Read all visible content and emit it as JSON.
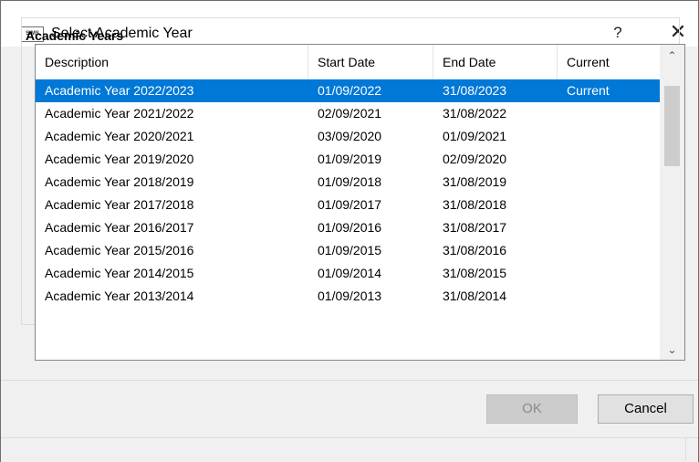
{
  "window": {
    "title": "Select Academic Year",
    "app_icon_label": "SIMS",
    "help_label": "?",
    "close_label": "✕"
  },
  "group": {
    "label": "Academic Years"
  },
  "table": {
    "columns": [
      "Description",
      "Start Date",
      "End Date",
      "Current"
    ],
    "rows": [
      {
        "description": "Academic Year 2022/2023",
        "start": "01/09/2022",
        "end": "31/08/2023",
        "current": "Current",
        "selected": true
      },
      {
        "description": "Academic Year 2021/2022",
        "start": "02/09/2021",
        "end": "31/08/2022",
        "current": ""
      },
      {
        "description": "Academic Year 2020/2021",
        "start": "03/09/2020",
        "end": "01/09/2021",
        "current": ""
      },
      {
        "description": "Academic Year 2019/2020",
        "start": "01/09/2019",
        "end": "02/09/2020",
        "current": ""
      },
      {
        "description": "Academic Year 2018/2019",
        "start": "01/09/2018",
        "end": "31/08/2019",
        "current": ""
      },
      {
        "description": "Academic Year 2017/2018",
        "start": "01/09/2017",
        "end": "31/08/2018",
        "current": ""
      },
      {
        "description": "Academic Year 2016/2017",
        "start": "01/09/2016",
        "end": "31/08/2017",
        "current": ""
      },
      {
        "description": "Academic Year 2015/2016",
        "start": "01/09/2015",
        "end": "31/08/2016",
        "current": ""
      },
      {
        "description": "Academic Year 2014/2015",
        "start": "01/09/2014",
        "end": "31/08/2015",
        "current": ""
      },
      {
        "description": "Academic Year 2013/2014",
        "start": "01/09/2013",
        "end": "31/08/2014",
        "current": ""
      }
    ]
  },
  "scrollbar": {
    "up_icon": "chevron-up-icon",
    "down_icon": "chevron-down-icon"
  },
  "buttons": {
    "ok_label": "OK",
    "cancel_label": "Cancel"
  },
  "colors": {
    "selection": "#0078d7"
  }
}
